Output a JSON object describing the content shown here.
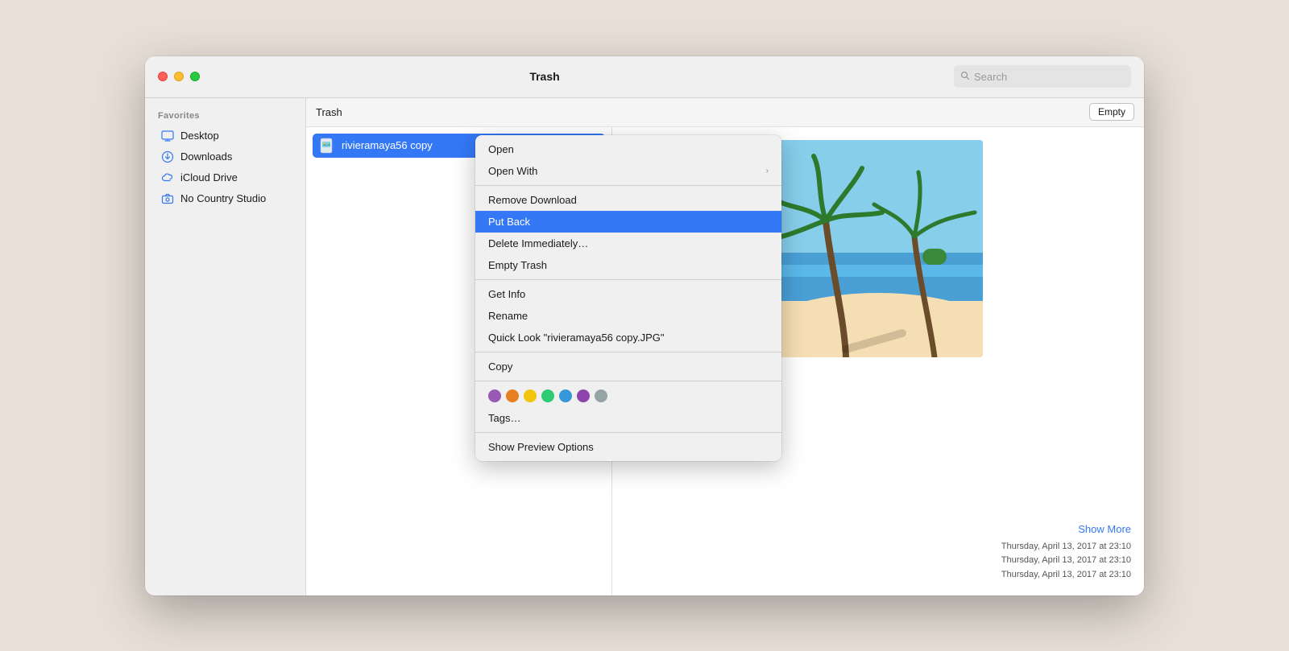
{
  "window": {
    "title": "Trash"
  },
  "titlebar": {
    "title": "Trash",
    "search_placeholder": "Search"
  },
  "sidebar": {
    "section_label": "Favorites",
    "items": [
      {
        "id": "desktop",
        "label": "Desktop",
        "icon": "desktop"
      },
      {
        "id": "downloads",
        "label": "Downloads",
        "icon": "download"
      },
      {
        "id": "icloud",
        "label": "iCloud Drive",
        "icon": "cloud"
      },
      {
        "id": "nocountry",
        "label": "No Country Studio",
        "icon": "camera"
      }
    ]
  },
  "toolbar": {
    "path_label": "Trash",
    "empty_button": "Empty"
  },
  "file_list": {
    "items": [
      {
        "name": "rivieramaya56 copy",
        "icon": "image",
        "selected": true
      }
    ]
  },
  "preview": {
    "show_more_label": "Show More",
    "dates": [
      "Thursday, April 13, 2017 at 23:10",
      "Thursday, April 13, 2017 at 23:10",
      "Thursday, April 13, 2017 at 23:10"
    ]
  },
  "context_menu": {
    "items": [
      {
        "id": "open",
        "label": "Open",
        "has_arrow": false,
        "highlighted": false
      },
      {
        "id": "open-with",
        "label": "Open With",
        "has_arrow": true,
        "highlighted": false
      },
      {
        "separator_after": true
      },
      {
        "id": "remove-download",
        "label": "Remove Download",
        "has_arrow": false,
        "highlighted": false
      },
      {
        "id": "put-back",
        "label": "Put Back",
        "has_arrow": false,
        "highlighted": true
      },
      {
        "id": "delete-immediately",
        "label": "Delete Immediately…",
        "has_arrow": false,
        "highlighted": false
      },
      {
        "id": "empty-trash",
        "label": "Empty Trash",
        "has_arrow": false,
        "highlighted": false
      },
      {
        "separator_after": true
      },
      {
        "id": "get-info",
        "label": "Get Info",
        "has_arrow": false,
        "highlighted": false
      },
      {
        "id": "rename",
        "label": "Rename",
        "has_arrow": false,
        "highlighted": false
      },
      {
        "id": "quick-look",
        "label": "Quick Look \"rivieramaya56 copy.JPG\"",
        "has_arrow": false,
        "highlighted": false
      },
      {
        "separator_after": true
      },
      {
        "id": "copy",
        "label": "Copy",
        "has_arrow": false,
        "highlighted": false
      },
      {
        "separator_after": true
      },
      {
        "id": "tags",
        "label": "Tags…",
        "has_arrow": false,
        "highlighted": false,
        "is_tags_row": false
      },
      {
        "separator_after": true
      },
      {
        "id": "show-preview-options",
        "label": "Show Preview Options",
        "has_arrow": false,
        "highlighted": false
      }
    ],
    "tag_colors": [
      "#9b59b6",
      "#e67e22",
      "#f1c40f",
      "#2ecc71",
      "#3498db",
      "#8e44ad",
      "#95a5a6"
    ]
  }
}
